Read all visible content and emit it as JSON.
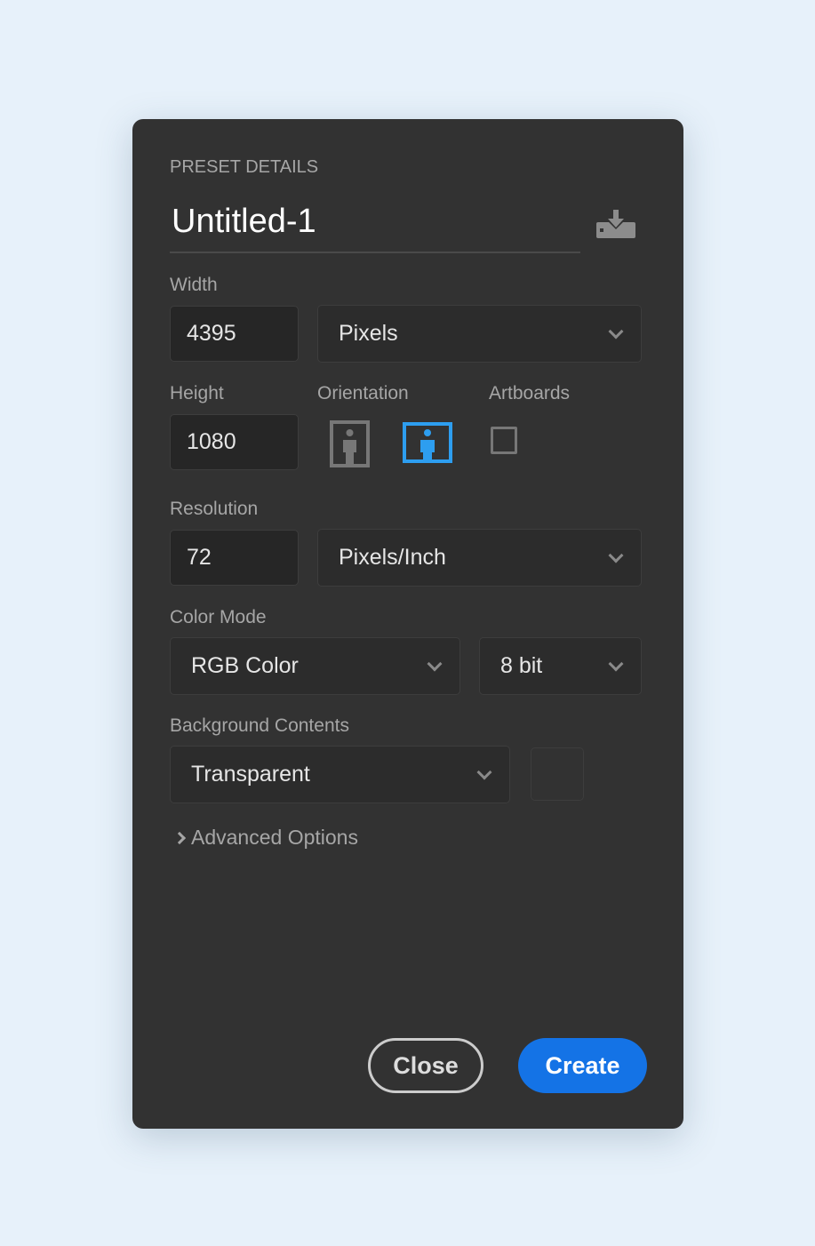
{
  "section_title": "PRESET DETAILS",
  "document_name": "Untitled-1",
  "save_preset_icon": "download-tray-icon",
  "width": {
    "label": "Width",
    "value": "4395",
    "unit": "Pixels"
  },
  "height": {
    "label": "Height",
    "value": "1080"
  },
  "orientation": {
    "label": "Orientation",
    "selected": "landscape"
  },
  "artboards": {
    "label": "Artboards",
    "checked": false
  },
  "resolution": {
    "label": "Resolution",
    "value": "72",
    "unit": "Pixels/Inch"
  },
  "color_mode": {
    "label": "Color Mode",
    "mode": "RGB Color",
    "depth": "8 bit"
  },
  "background": {
    "label": "Background Contents",
    "value": "Transparent"
  },
  "advanced": "Advanced Options",
  "buttons": {
    "close": "Close",
    "create": "Create"
  },
  "colors": {
    "accent": "#1473e6",
    "selected_icon": "#2d9ef0",
    "panel": "#323232"
  }
}
